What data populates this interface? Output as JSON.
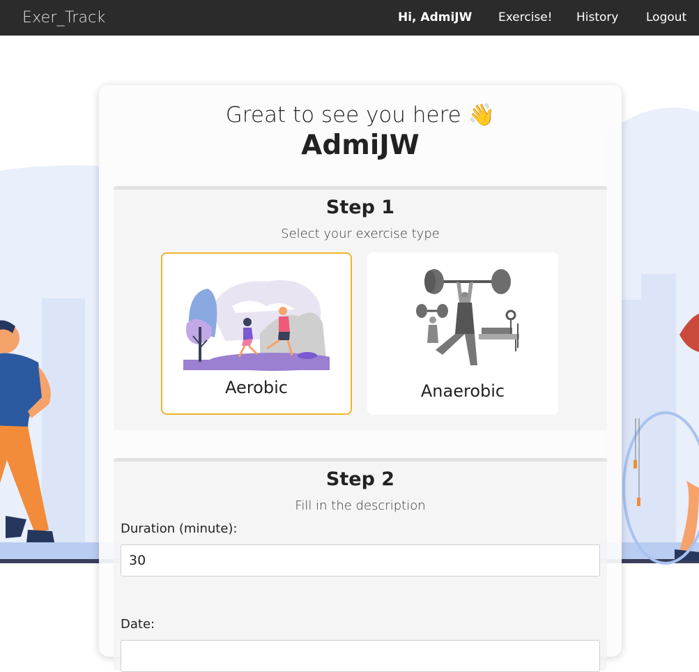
{
  "navbar": {
    "brand": "Exer_Track",
    "greeting": "Hi, AdmiJW",
    "links": [
      "Exercise!",
      "History",
      "Logout"
    ]
  },
  "card": {
    "greeting": "Great to see you here 👋",
    "username": "AdmiJW"
  },
  "step1": {
    "title": "Step 1",
    "subtitle": "Select your exercise type",
    "options": [
      {
        "label": "Aerobic",
        "selected": true,
        "icon": "running-people-illustration"
      },
      {
        "label": "Anaerobic",
        "selected": false,
        "icon": "weightlifting-illustration"
      }
    ]
  },
  "step2": {
    "title": "Step 2",
    "subtitle": "Fill in the description",
    "duration_label": "Duration (minute):",
    "duration_value": "30",
    "date_label": "Date:"
  },
  "colors": {
    "navbar": "#2b2b2b",
    "selected_border": "#f0b429",
    "background_accent": "#e8eefb"
  }
}
